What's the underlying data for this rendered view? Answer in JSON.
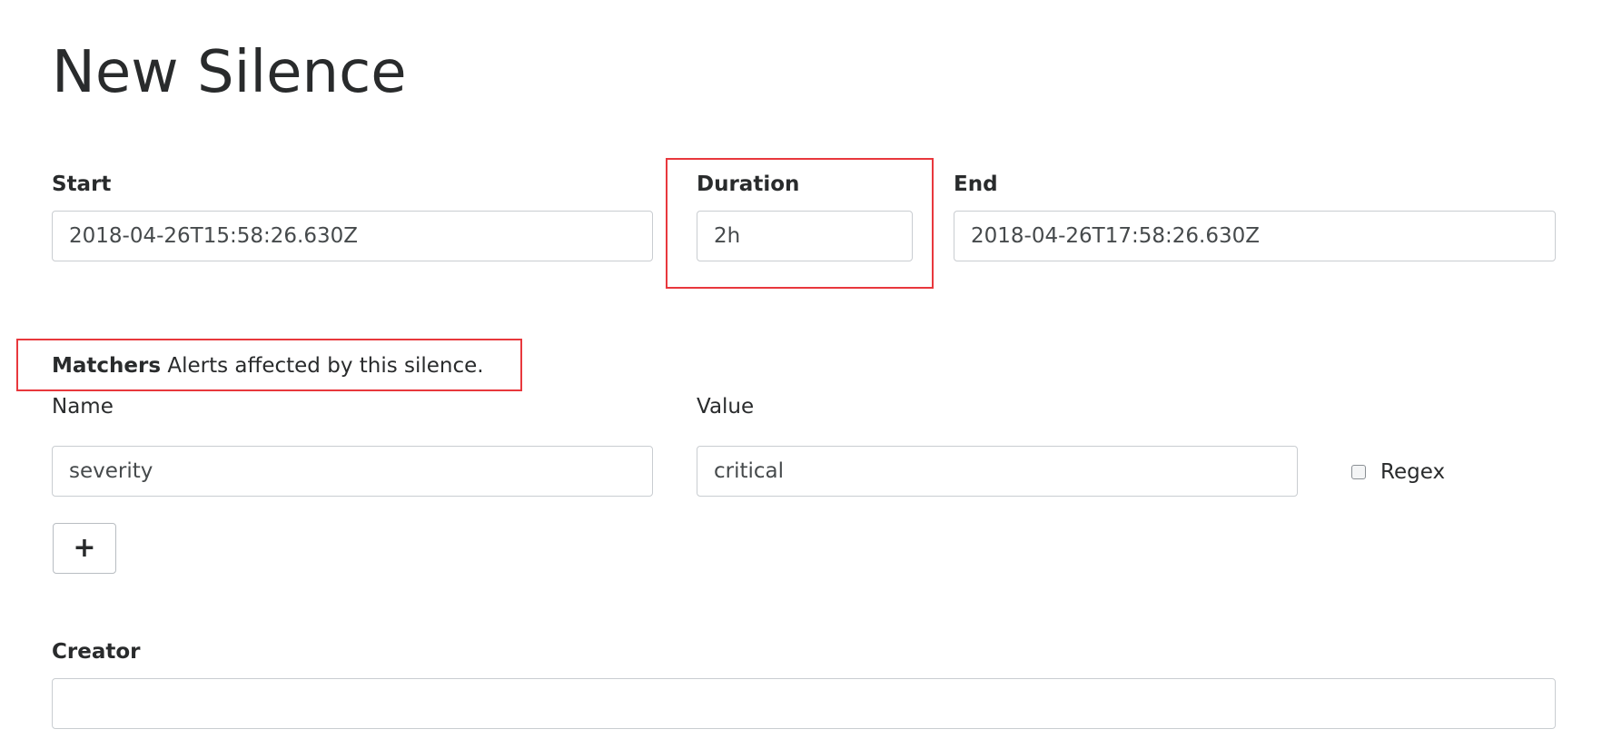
{
  "page": {
    "title": "New Silence"
  },
  "fields": {
    "start": {
      "label": "Start",
      "value": "2018-04-26T15:58:26.630Z"
    },
    "duration": {
      "label": "Duration",
      "value": "2h"
    },
    "end": {
      "label": "End",
      "value": "2018-04-26T17:58:26.630Z"
    },
    "creator": {
      "label": "Creator",
      "value": ""
    }
  },
  "matchers": {
    "heading": "Matchers",
    "description": "Alerts affected by this silence.",
    "name_label": "Name",
    "value_label": "Value",
    "regex_label": "Regex",
    "regex_checked": false,
    "rows": [
      {
        "name": "severity",
        "value": "critical"
      }
    ],
    "add_button_label": "+"
  },
  "highlight_color": "#e8383d"
}
